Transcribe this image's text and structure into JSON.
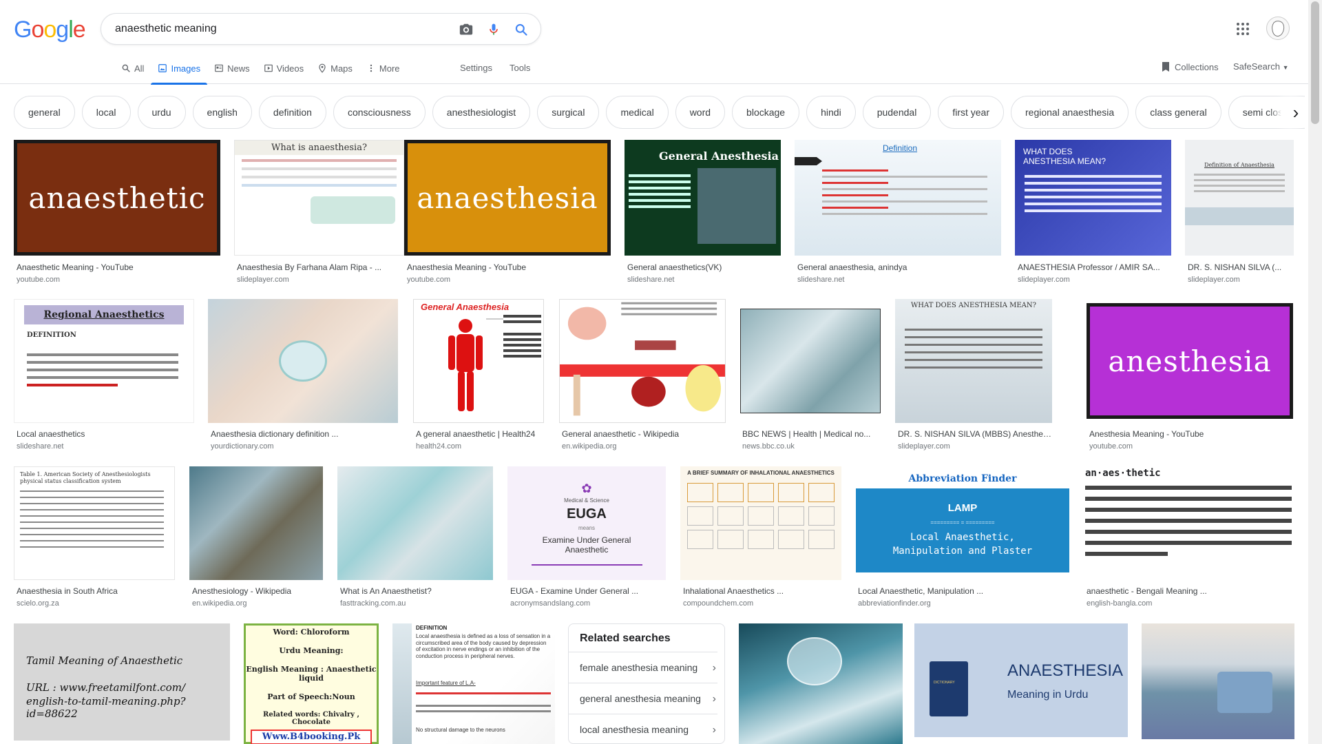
{
  "logo": "Google",
  "search": {
    "query": "anaesthetic meaning"
  },
  "tabs": [
    "All",
    "Images",
    "News",
    "Videos",
    "Maps",
    "More"
  ],
  "settings_label": "Settings",
  "tools_label": "Tools",
  "collections_label": "Collections",
  "safesearch_label": "SafeSearch",
  "chips": [
    "general",
    "local",
    "urdu",
    "english",
    "definition",
    "consciousness",
    "anesthesiologist",
    "surgical",
    "medical",
    "word",
    "blockage",
    "hindi",
    "pudendal",
    "first year",
    "regional anaesthesia",
    "class general",
    "semi closed m"
  ],
  "row1": [
    {
      "title": "Anaesthetic Meaning - YouTube",
      "source": "youtube.com",
      "thumb_text": "anaesthetic"
    },
    {
      "title": "Anaesthesia By Farhana Alam Ripa - ...",
      "source": "slideplayer.com",
      "thumb_text": "What is anaesthesia?"
    },
    {
      "title": "Anaesthesia Meaning - YouTube",
      "source": "youtube.com",
      "thumb_text": "anaesthesia"
    },
    {
      "title": "General anaesthetics(VK)",
      "source": "slideshare.net",
      "thumb_text": "General Anesthesia"
    },
    {
      "title": "General anaesthesia, anindya",
      "source": "slideshare.net",
      "thumb_text": "Definition"
    },
    {
      "title": "ANAESTHESIA Professor / AMIR SA...",
      "source": "slideplayer.com",
      "thumb_text": "WHAT DOES ANESTHESIA MEAN?"
    },
    {
      "title": "DR. S. NISHAN SILVA (...",
      "source": "slideplayer.com",
      "thumb_text": "Definition of Anaesthesia"
    }
  ],
  "row2": [
    {
      "title": "Local anaesthetics",
      "source": "slideshare.net",
      "thumb_text": "Regional Anaesthetics"
    },
    {
      "title": "Anaesthesia dictionary definition ...",
      "source": "yourdictionary.com",
      "thumb_text": ""
    },
    {
      "title": "A general anaesthetic | Health24",
      "source": "health24.com",
      "thumb_text": "General Anaesthesia"
    },
    {
      "title": "General anaesthetic - Wikipedia",
      "source": "en.wikipedia.org",
      "thumb_text": ""
    },
    {
      "title": "BBC NEWS | Health | Medical no...",
      "source": "news.bbc.co.uk",
      "thumb_text": ""
    },
    {
      "title": "DR. S. NISHAN SILVA (MBBS) Anesthesia ...",
      "source": "slideplayer.com",
      "thumb_text": "WHAT DOES ANESTHESIA MEAN?"
    },
    {
      "title": "Anesthesia Meaning - YouTube",
      "source": "youtube.com",
      "thumb_text": "anesthesia"
    }
  ],
  "row3": [
    {
      "title": "Anaesthesia in South Africa",
      "source": "scielo.org.za",
      "thumb_text": "Table 1. American Society of Anesthesiologists physical status classification system"
    },
    {
      "title": "Anesthesiology - Wikipedia",
      "source": "en.wikipedia.org",
      "thumb_text": ""
    },
    {
      "title": "What is An Anaesthetist?",
      "source": "fasttracking.com.au",
      "thumb_text": ""
    },
    {
      "title": "EUGA - Examine Under General ...",
      "source": "acronymsandslang.com",
      "thumb_text": "EUGA"
    },
    {
      "title": "Inhalational Anaesthetics ...",
      "source": "compoundchem.com",
      "thumb_text": "A BRIEF SUMMARY OF INHALATIONAL ANAESTHETICS"
    },
    {
      "title": "Local Anaesthetic, Manipulation ...",
      "source": "abbreviationfinder.org",
      "thumb_text": "Local Anaesthetic, Manipulation and Plaster"
    },
    {
      "title": "anaesthetic - Bengali Meaning ...",
      "source": "english-bangla.com",
      "thumb_text": "an·aes·thetic"
    }
  ],
  "row4": {
    "tamil": {
      "line1": "Tamil Meaning of Anaesthetic",
      "line2": "URL : www.freetamilfont.com/",
      "line3": "english-to-tamil-meaning.php?id=88622"
    },
    "urdu": {
      "l1": "Word: Chloroform",
      "l2": "Urdu Meaning:",
      "l3": "English Meaning : Anaesthetic liquid",
      "l4": "Part of Speech:Noun",
      "l5": "Related words: Chivalry , Chocolate",
      "l6": "Www.B4booking.Pk"
    },
    "definition": {
      "head": "DEFINITION",
      "line1": "Local anaesthesia is defined as a loss of sensation in a circumscribed area of the body caused by depression of excitation in nerve endings or an inhibition of the conduction process in peripheral nerves.",
      "line2": "Important feature of L.A-",
      "line3": "No structural damage to the neurons"
    },
    "dict": {
      "title": "ANAESTHESIA",
      "sub": "Meaning in Urdu",
      "book": "DICTIONARY"
    }
  },
  "related": {
    "heading": "Related searches",
    "items": [
      "female anesthesia meaning",
      "general anesthesia meaning",
      "local anesthesia meaning"
    ]
  },
  "colors": {
    "accent": "#1a73e8",
    "border": "#dfe1e5"
  }
}
